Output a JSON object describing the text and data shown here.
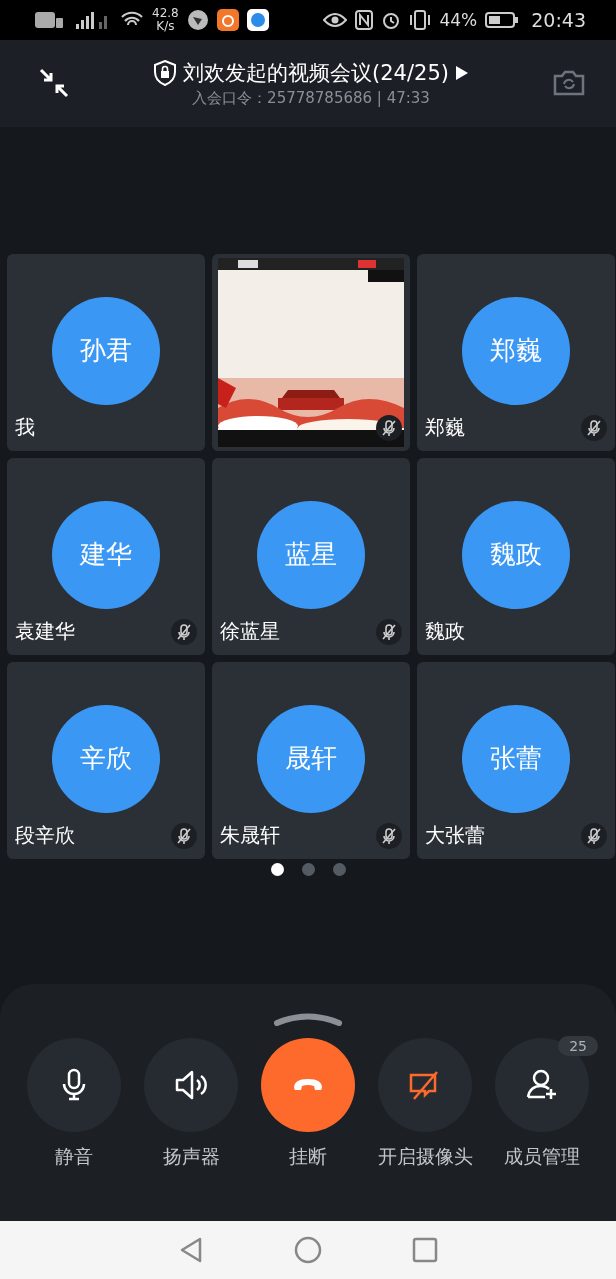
{
  "status_bar": {
    "speed": "42.8",
    "speed_unit": "K/s",
    "battery": "44%",
    "time": "20:43"
  },
  "header": {
    "title": "刘欢发起的视频会议(24/25)",
    "subtitle": "入会口令：25778785686 | 47:33"
  },
  "participants": [
    {
      "kind": "avatar",
      "avatar_text": "孙君",
      "name": "我",
      "muted": false
    },
    {
      "kind": "video",
      "muted": true
    },
    {
      "kind": "avatar",
      "avatar_text": "郑巍",
      "name": "郑巍",
      "muted": true
    },
    {
      "kind": "avatar",
      "avatar_text": "建华",
      "name": "袁建华",
      "muted": true
    },
    {
      "kind": "avatar",
      "avatar_text": "蓝星",
      "name": "徐蓝星",
      "muted": true
    },
    {
      "kind": "avatar",
      "avatar_text": "魏政",
      "name": "魏政",
      "muted": false
    },
    {
      "kind": "avatar",
      "avatar_text": "辛欣",
      "name": "段辛欣",
      "muted": true
    },
    {
      "kind": "avatar",
      "avatar_text": "晟轩",
      "name": "朱晟轩",
      "muted": true
    },
    {
      "kind": "avatar",
      "avatar_text": "张蕾",
      "name": "大张蕾",
      "muted": true
    }
  ],
  "pages": [
    {
      "selected": true
    },
    {
      "selected": false
    },
    {
      "selected": false
    }
  ],
  "controls": [
    {
      "kind": "mic",
      "label": "静音"
    },
    {
      "kind": "speaker",
      "label": "扬声器"
    },
    {
      "kind": "hangup",
      "label": "挂断"
    },
    {
      "kind": "camera",
      "label": "开启摄像头"
    },
    {
      "kind": "members",
      "label": "成员管理",
      "badge": "25"
    }
  ]
}
